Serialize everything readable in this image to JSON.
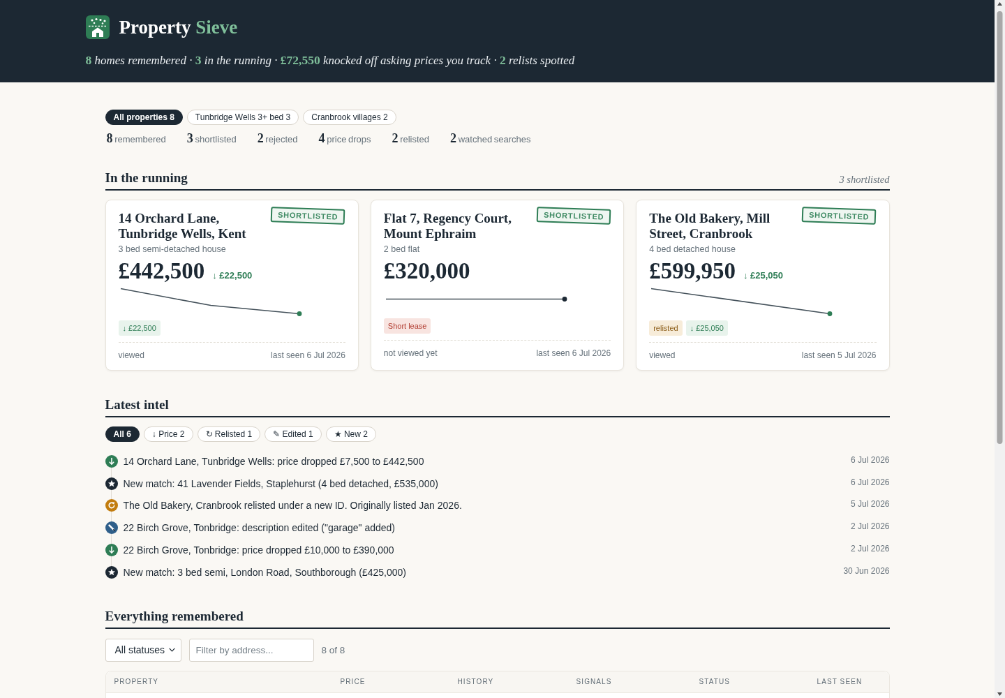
{
  "header": {
    "brand": {
      "name": "Property",
      "accent": "Sieve"
    },
    "summary": "**8** homes remembered · **3** in the running · **£72,550** knocked off asking prices you track · **2** relists spotted"
  },
  "views": [
    {
      "label": "All properties 8",
      "selected": true
    },
    {
      "label": "Tunbridge Wells 3+ bed 3",
      "selected": false
    },
    {
      "label": "Cranbrook villages 2",
      "selected": false
    }
  ],
  "stats": [
    {
      "value": "8",
      "label": "remembered"
    },
    {
      "value": "3",
      "label": "shortlisted"
    },
    {
      "value": "2",
      "label": "rejected"
    },
    {
      "value": "4",
      "label": "price drops"
    },
    {
      "value": "2",
      "label": "relisted"
    },
    {
      "value": "2",
      "label": "watched searches"
    }
  ],
  "running": {
    "title": "In the running",
    "count": "3 shortlisted",
    "cards": [
      {
        "address": "14 Orchard Lane, Tunbridge Wells, Kent",
        "status": "SHORTLISTED",
        "type": "3 bed semi-detached house",
        "price": "£442,500",
        "drop": "↓ £22,500",
        "sparkline": {
          "kind": "stepped"
        },
        "tags": [
          {
            "kind": "drop",
            "text": "↓ £22,500"
          }
        ],
        "viewing": "viewed",
        "last_seen": "last seen 6 Jul 2026"
      },
      {
        "address": "Flat 7, Regency Court, Mount Ephraim",
        "status": "SHORTLISTED",
        "type": "2 bed flat",
        "price": "£320,000",
        "sparkline": {
          "kind": "flat"
        },
        "tags": [
          {
            "kind": "warning",
            "text": "Short lease"
          }
        ],
        "viewing": "not viewed yet",
        "last_seen": "last seen 6 Jul 2026"
      },
      {
        "address": "The Old Bakery, Mill Street, Cranbrook",
        "status": "SHORTLISTED",
        "type": "4 bed detached house",
        "price": "£599,950",
        "drop": "↓ £25,050",
        "sparkline": {
          "kind": "falling"
        },
        "tags": [
          {
            "kind": "relisted",
            "text": "relisted"
          },
          {
            "kind": "drop",
            "text": "↓ £25,050"
          }
        ],
        "viewing": "viewed",
        "last_seen": "last seen 5 Jul 2026"
      }
    ]
  },
  "intel": {
    "title": "Latest intel",
    "filters": [
      {
        "label": "All 6",
        "selected": true
      },
      {
        "label": "↓ Price 2",
        "selected": false
      },
      {
        "label": "↻ Relisted 1",
        "selected": false
      },
      {
        "label": "✎ Edited 1",
        "selected": false
      },
      {
        "label": "★ New 2",
        "selected": false
      }
    ],
    "items": [
      {
        "kind": "price",
        "text": "14 Orchard Lane, Tunbridge Wells: price dropped £7,500 to £442,500",
        "date": "6 Jul 2026"
      },
      {
        "kind": "new",
        "text": "New match: 41 Lavender Fields, Staplehurst (4 bed detached, £535,000)",
        "date": "6 Jul 2026"
      },
      {
        "kind": "relisted",
        "text": "The Old Bakery, Cranbrook relisted under a new ID. Originally listed Jan 2026.",
        "date": "5 Jul 2026"
      },
      {
        "kind": "edited",
        "text": "22 Birch Grove, Tonbridge: description edited (\"garage\" added)",
        "date": "2 Jul 2026"
      },
      {
        "kind": "price",
        "text": "22 Birch Grove, Tonbridge: price dropped £10,000 to £390,000",
        "date": "2 Jul 2026"
      },
      {
        "kind": "new",
        "text": "New match: 3 bed semi, London Road, Southborough (£425,000)",
        "date": "30 Jun 2026"
      }
    ]
  },
  "remembered": {
    "title": "Everything remembered",
    "status_select": {
      "value": "All statuses"
    },
    "address_filter": {
      "placeholder": "Filter by address..."
    },
    "count": "8 of 8",
    "table": {
      "columns": [
        "PROPERTY",
        "PRICE",
        "HISTORY",
        "SIGNALS",
        "STATUS",
        "LAST SEEN"
      ]
    }
  }
}
